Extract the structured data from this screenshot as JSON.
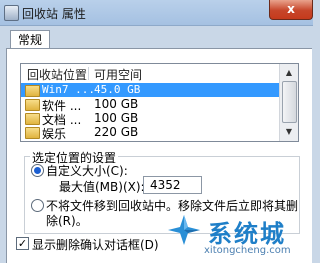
{
  "window": {
    "title": "回收站 属性",
    "close_label": "x"
  },
  "tabs": [
    {
      "label": "常规"
    }
  ],
  "recycle_list": {
    "columns": [
      "回收站位置",
      "可用空间"
    ],
    "rows": [
      {
        "name": "Win7 ...",
        "space": "45.0 GB",
        "selected": true
      },
      {
        "name": "软件 ...",
        "space": "100 GB",
        "selected": false
      },
      {
        "name": "文档 ...",
        "space": "100 GB",
        "selected": false
      },
      {
        "name": "娱乐",
        "space": "220 GB",
        "selected": false
      }
    ]
  },
  "settings": {
    "group_label": "选定位置的设置",
    "custom_size_label": "自定义大小(C):",
    "max_value_label": "最大值(MB)(X):",
    "max_value": "4352",
    "no_move_label_line1": "不将文件移到回收站中。移除文件后立即将其删",
    "no_move_label_line2": "除(R)。",
    "custom_size_checked": true,
    "no_move_checked": false
  },
  "confirm": {
    "label": "显示删除确认对话框(D)",
    "checked": true
  },
  "watermark": {
    "brand": "系统城",
    "url": "xitongcheng.com"
  },
  "colors": {
    "selection": "#3399ff",
    "close_button": "#c7462a",
    "brand": "#1f7fc8"
  }
}
